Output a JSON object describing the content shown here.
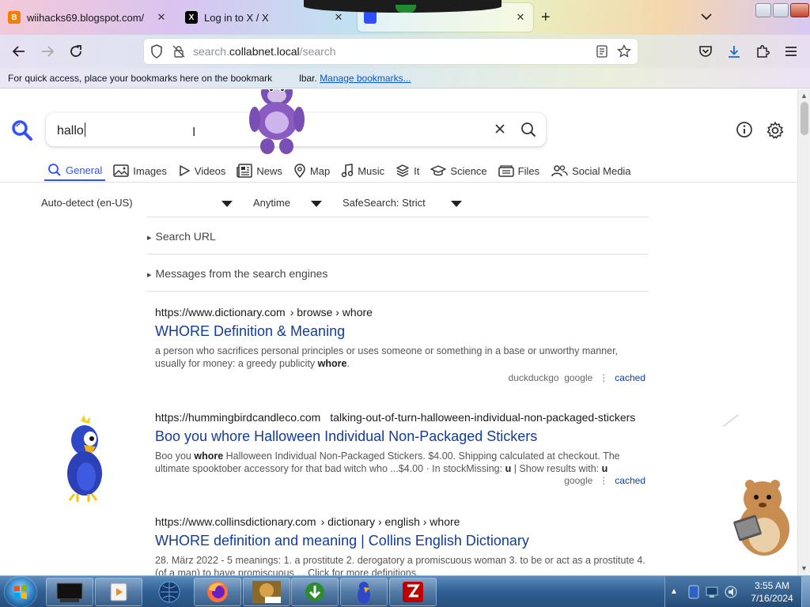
{
  "browser": {
    "tabs": [
      {
        "title": "wiihacks69.blogspot.com/",
        "favicon": "blogger-icon",
        "color": "#f57d00"
      },
      {
        "title": "Log in to X / X",
        "favicon": "x-icon",
        "color": "#000000"
      },
      {
        "title": "",
        "favicon": "searxng-icon",
        "color": "#3050ff"
      }
    ],
    "url": {
      "prefix": "search.",
      "domain": "collabnet.local",
      "path": "/search"
    },
    "bookmarks_bar": {
      "message_start": "For quick access, place your bookmarks here on the bookmark",
      "message_end": "lbar.",
      "manage_label": "Manage bookmarks..."
    }
  },
  "search": {
    "query": "hallo",
    "categories": [
      {
        "label": "General",
        "icon": "search-icon",
        "active": true
      },
      {
        "label": "Images",
        "icon": "image-icon",
        "active": false
      },
      {
        "label": "Videos",
        "icon": "play-icon",
        "active": false
      },
      {
        "label": "News",
        "icon": "newspaper-icon",
        "active": false
      },
      {
        "label": "Map",
        "icon": "map-pin-icon",
        "active": false
      },
      {
        "label": "Music",
        "icon": "music-note-icon",
        "active": false
      },
      {
        "label": "It",
        "icon": "layers-icon",
        "active": false
      },
      {
        "label": "Science",
        "icon": "graduation-cap-icon",
        "active": false
      },
      {
        "label": "Files",
        "icon": "files-icon",
        "active": false
      },
      {
        "label": "Social Media",
        "icon": "people-icon",
        "active": false
      }
    ],
    "filters": {
      "language": "Auto-detect (en-US)",
      "time": "Anytime",
      "safesearch": "SafeSearch: Strict"
    },
    "sections": {
      "search_url": "Search URL",
      "engine_messages": "Messages from the search engines"
    },
    "results": [
      {
        "host": "https://www.dictionary.com",
        "path": "› browse › whore",
        "title": "WHORE Definition & Meaning",
        "snippet_pre": "a person who sacrifices personal principles or uses someone or something in a base or unworthy manner, usually for money: a greedy publicity ",
        "snippet_bold": "whore",
        "snippet_post": ".",
        "engines": [
          "duckduckgo",
          "google"
        ],
        "cached": "cached"
      },
      {
        "host": "https://hummingbirdcandleco.com",
        "path": "talking-out-of-turn-halloween-individual-non-packaged-stickers",
        "title": "Boo you whore Halloween Individual Non-Packaged Stickers",
        "snippet_pre": "Boo you ",
        "snippet_bold": "whore",
        "snippet_post": " Halloween Individual Non-Packaged Stickers. $4.00. Shipping calculated at checkout. The ultimate spooktober accessory for that bad witch who ...$4.00 · In stockMissing: ",
        "snippet_bold2": "u",
        "snippet_post2": " | Show results with: ",
        "snippet_bold3": "u",
        "engines": [
          "google"
        ],
        "cached": "cached"
      },
      {
        "host": "https://www.collinsdictionary.com",
        "path": "› dictionary › english › whore",
        "title": "WHORE definition and meaning | Collins English Dictionary",
        "snippet_pre": "28. März 2022 - 5 meanings: 1. a prostitute 2. derogatory a promiscuous woman 3. to be or act as a prostitute 4. (of a man) to have promiscuous ... Click for more definitions."
      }
    ]
  },
  "taskbar": {
    "items": [
      "desktop-app-icon",
      "media-player-icon",
      "globe-icon",
      "firefox-icon",
      "bonzi-buddy-icon",
      "download-manager-icon",
      "parrot-icon",
      "filezilla-icon"
    ],
    "clock_time": "3:55 AM",
    "clock_date": "7/16/2024"
  },
  "colors": {
    "accent": "#3050ff",
    "result_title": "#123c9a",
    "link": "#0b57d0"
  }
}
